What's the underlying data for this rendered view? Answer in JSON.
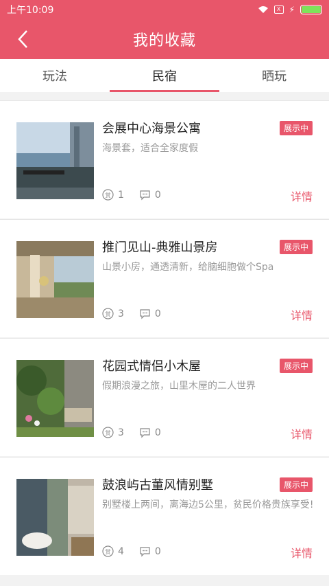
{
  "status": {
    "time": "上午10:09",
    "sim_label": "X"
  },
  "header": {
    "title": "我的收藏"
  },
  "tabs": [
    {
      "label": "玩法"
    },
    {
      "label": "民宿"
    },
    {
      "label": "晒玩"
    }
  ],
  "active_tab": 1,
  "items": [
    {
      "title": "会展中心海景公寓",
      "badge": "展示中",
      "desc": "海景套，适合全家度假",
      "likes": "1",
      "comments": "0",
      "detail": "详情"
    },
    {
      "title": "推门见山-典雅山景房",
      "badge": "展示中",
      "desc": "山景小房，通透清新，给脑细胞做个Spa",
      "likes": "3",
      "comments": "0",
      "detail": "详情"
    },
    {
      "title": "花园式情侣小木屋",
      "badge": "展示中",
      "desc": "假期浪漫之旅，山里木屋的二人世界",
      "likes": "3",
      "comments": "0",
      "detail": "详情"
    },
    {
      "title": "鼓浪屿古董风情别墅",
      "badge": "展示中",
      "desc": "别墅楼上两间，离海边5公里，贫民价格贵族享受!",
      "likes": "4",
      "comments": "0",
      "detail": "详情"
    }
  ],
  "icons": {
    "like": "reward-icon",
    "comment": "comment-icon",
    "back": "back-arrow-icon"
  },
  "colors": {
    "accent": "#e8566a"
  }
}
